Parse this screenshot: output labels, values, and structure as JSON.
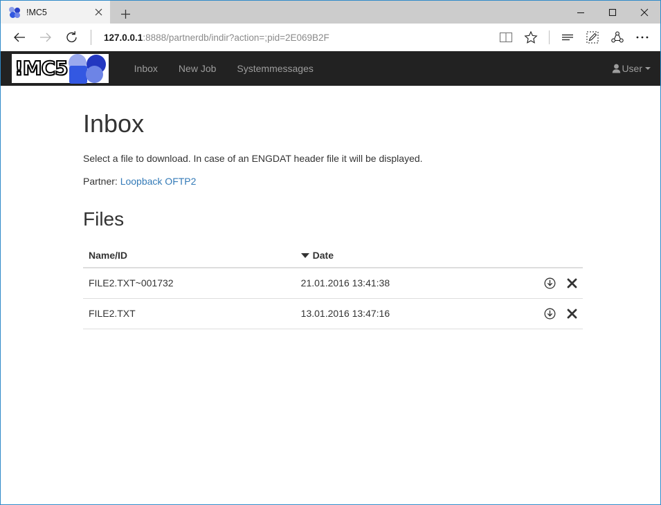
{
  "browser": {
    "tab": {
      "title": "!MC5",
      "favicon_icon": "mc5-dots-favicon",
      "close_icon": "close-icon"
    },
    "newtab_label": "+",
    "window_controls": {
      "minimize_icon": "minimize-icon",
      "maximize_icon": "maximize-icon",
      "close_icon": "close-icon"
    },
    "nav": {
      "back_icon": "back-arrow-icon",
      "forward_icon": "forward-arrow-icon",
      "refresh_icon": "refresh-icon"
    },
    "address": {
      "host": "127.0.0.1",
      "path": ":8888/partnerdb/indir?action=;pid=2E069B2F",
      "full": "127.0.0.1:8888/partnerdb/indir?action=;pid=2E069B2F"
    },
    "toolbar_icons": [
      {
        "name": "reading-view-icon"
      },
      {
        "name": "favorites-star-icon"
      },
      {
        "name": "hub-icon"
      },
      {
        "name": "web-note-icon"
      },
      {
        "name": "share-icon"
      },
      {
        "name": "more-icon"
      }
    ]
  },
  "site": {
    "brand": {
      "text": "!MC5",
      "mark_icon": "mc5-dots-logo"
    },
    "links": [
      {
        "label": "Inbox"
      },
      {
        "label": "New Job"
      },
      {
        "label": "Systemmessages"
      }
    ],
    "user_menu": {
      "label": "User",
      "icon": "user-icon"
    }
  },
  "page": {
    "title": "Inbox",
    "description": "Select a file to download. In case of an ENGDAT header file it will be displayed.",
    "partner_label": "Partner:",
    "partner_link": "Loopback OFTP2",
    "section_title": "Files",
    "table": {
      "headers": {
        "name": "Name/ID",
        "date": "Date",
        "sort_icon": "sort-descending-caret"
      },
      "rows": [
        {
          "name": "FILE2.TXT~001732",
          "date": "21.01.2016 13:41:38",
          "download_icon": "download-icon",
          "delete_icon": "delete-x-icon"
        },
        {
          "name": "FILE2.TXT",
          "date": "13.01.2016 13:47:16",
          "download_icon": "download-icon",
          "delete_icon": "delete-x-icon"
        }
      ]
    }
  },
  "colors": {
    "navbar_bg": "#222222",
    "nav_link": "#9d9d9d",
    "link": "#337ab7",
    "window_border": "#2f8ac9",
    "titlebar_bg": "#cccccc",
    "brand_blue": "#3358e2"
  }
}
